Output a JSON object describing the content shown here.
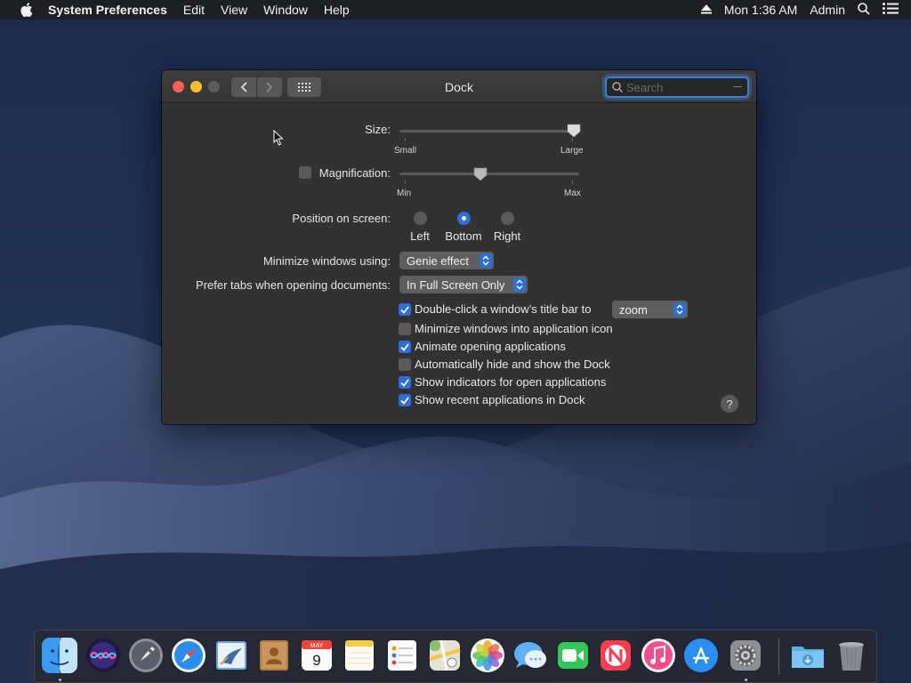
{
  "menubar": {
    "app_name": "System Preferences",
    "items": [
      "Edit",
      "View",
      "Window",
      "Help"
    ],
    "clock": "Mon 1:36 AM",
    "user": "Admin"
  },
  "window": {
    "title": "Dock",
    "search_placeholder": "Search"
  },
  "settings": {
    "size": {
      "label": "Size:",
      "min_label": "Small",
      "max_label": "Large",
      "value": 0.97
    },
    "magnification": {
      "label": "Magnification:",
      "min_label": "Min",
      "max_label": "Max",
      "value": 0.45,
      "enabled": false
    },
    "position": {
      "label": "Position on screen:",
      "options": [
        "Left",
        "Bottom",
        "Right"
      ],
      "selected": "Bottom"
    },
    "minimize_using": {
      "label": "Minimize windows using:",
      "value": "Genie effect"
    },
    "prefer_tabs": {
      "label": "Prefer tabs when opening documents:",
      "value": "In Full Screen Only"
    },
    "double_click": {
      "label": "Double-click a window’s title bar to",
      "value": "zoom",
      "checked": true
    },
    "checkboxes": [
      {
        "label": "Minimize windows into application icon",
        "checked": false
      },
      {
        "label": "Animate opening applications",
        "checked": true
      },
      {
        "label": "Automatically hide and show the Dock",
        "checked": false
      },
      {
        "label": "Show indicators for open applications",
        "checked": true
      },
      {
        "label": "Show recent applications in Dock",
        "checked": true
      }
    ],
    "help": "?"
  },
  "dock": {
    "calendar_month": "MAY",
    "calendar_day": "9",
    "apps": [
      "Finder",
      "Siri",
      "Launchpad",
      "Safari",
      "Mail",
      "Contacts",
      "Calendar",
      "Notes",
      "Reminders",
      "Maps",
      "Photos",
      "Messages",
      "FaceTime",
      "News",
      "iTunes",
      "App Store",
      "System Preferences",
      "Downloads",
      "Trash"
    ]
  },
  "colors": {
    "accent": "#2d6fd8",
    "window_bg": "#323232",
    "close": "#fc5f57",
    "minimize": "#febc2e"
  }
}
